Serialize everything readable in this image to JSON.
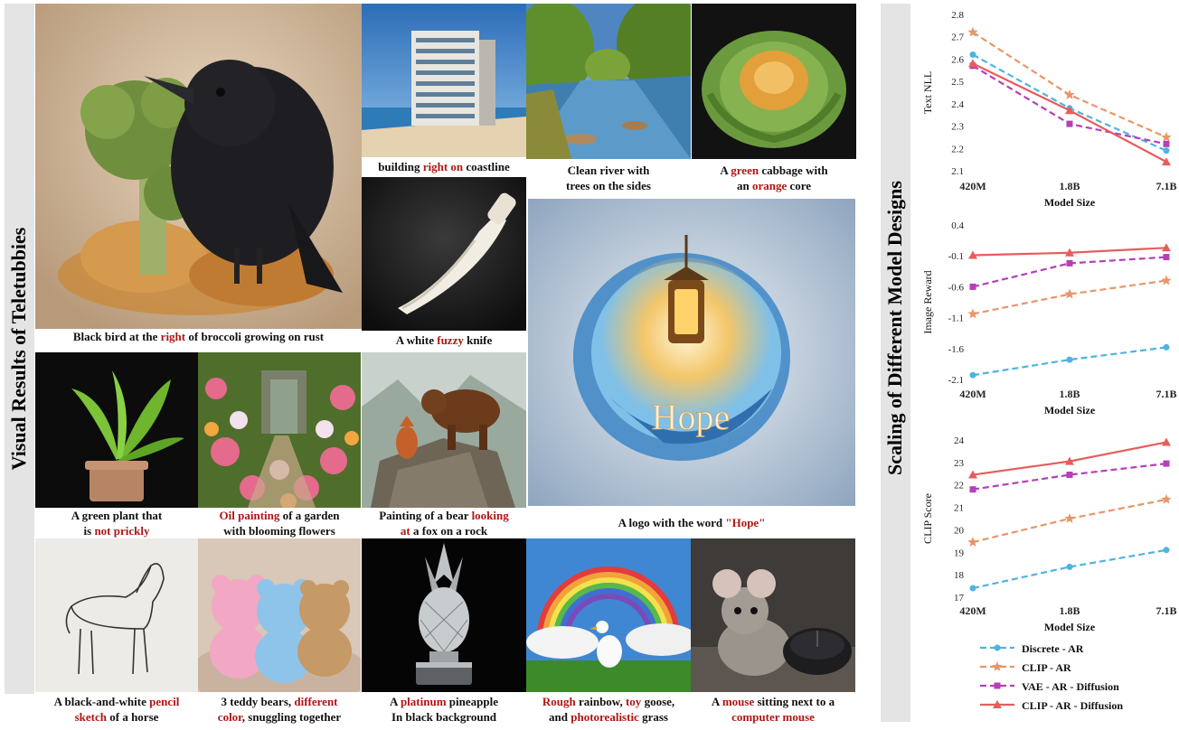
{
  "left_title": "Visual Results of Teletubbies",
  "right_title": "Scaling of Different Model Designs",
  "captions": {
    "bird": [
      "Black bird at the ",
      "right",
      " of broccoli growing on rust"
    ],
    "building": [
      "building ",
      "right on",
      " coastline"
    ],
    "river_1": "Clean river with",
    "river_2": "trees on the sides",
    "cabbage_1": [
      "A ",
      "green",
      " cabbage with"
    ],
    "cabbage_2": [
      "an ",
      "orange",
      " core"
    ],
    "knife": [
      "A white ",
      "fuzzy",
      " knife"
    ],
    "plant_1": "A green plant that",
    "plant_2": [
      "is ",
      "not prickly"
    ],
    "garden_1": [
      "Oil painting",
      " of a garden"
    ],
    "garden_2": "with blooming flowers",
    "bear_1": [
      "Painting of a bear ",
      "looking"
    ],
    "bear_2": [
      "at",
      " a fox on a rock"
    ],
    "logo": [
      "A logo with the word ",
      "\"Hope\""
    ],
    "horse_1": [
      "A black-and-white ",
      "pencil"
    ],
    "horse_2": [
      "sketch",
      " of a horse"
    ],
    "teddy_1": [
      "3 teddy bears, ",
      "different"
    ],
    "teddy_2": [
      "color",
      ", snuggling together"
    ],
    "pineapple_1": [
      "A ",
      "platinum",
      " pineapple"
    ],
    "pineapple_2": "In black background",
    "rainbow_1": [
      "Rough",
      " rainbow, ",
      "toy",
      " goose,"
    ],
    "rainbow_2": [
      "and ",
      "photorealistic",
      " grass"
    ],
    "mouse_1": [
      "A ",
      "mouse",
      " sitting next to a"
    ],
    "mouse_2": [
      "computer mouse"
    ]
  },
  "logo_word": "Hope",
  "colors": {
    "discrete_ar": "#4fb3e0",
    "clip_ar": "#e8956a",
    "vae_ar_diffusion": "#b53fb8",
    "clip_ar_diffusion": "#e85c5c",
    "highlight": "#b01515",
    "sidebar": "#e4e4e4"
  },
  "legend": [
    {
      "name": "Discrete - AR",
      "color": "#4fb3e0",
      "marker": "circle",
      "dashed": true
    },
    {
      "name": "CLIP - AR",
      "color": "#e8956a",
      "marker": "star",
      "dashed": true
    },
    {
      "name": "VAE - AR - Diffusion",
      "color": "#b53fb8",
      "marker": "square",
      "dashed": true
    },
    {
      "name": "CLIP - AR - Diffusion",
      "color": "#e85c5c",
      "marker": "triangle",
      "dashed": false
    }
  ],
  "chart_data": [
    {
      "type": "line",
      "x": [
        "420M",
        "1.8B",
        "7.1B"
      ],
      "xlabel": "Model Size",
      "ylabel": "Text NLL",
      "ylim": [
        2.1,
        2.8
      ],
      "yticks": [
        "2.8",
        "2.7",
        "2.6",
        "2.5",
        "2.4",
        "2.3",
        "2.2",
        "2.1"
      ],
      "series": [
        {
          "name": "Discrete - AR",
          "values": [
            2.62,
            2.38,
            2.19
          ]
        },
        {
          "name": "CLIP - AR",
          "values": [
            2.72,
            2.44,
            2.25
          ]
        },
        {
          "name": "VAE - AR - Diffusion",
          "values": [
            2.57,
            2.31,
            2.22
          ]
        },
        {
          "name": "CLIP - AR - Diffusion",
          "values": [
            2.58,
            2.37,
            2.14
          ]
        }
      ]
    },
    {
      "type": "line",
      "x": [
        "420M",
        "1.8B",
        "7.1B"
      ],
      "xlabel": "Model Size",
      "ylabel": "Image Reward",
      "ylim": [
        -2.1,
        0.4
      ],
      "yticks": [
        "0.4",
        "-0.1",
        "-0.6",
        "-1.1",
        "-1.6",
        "-2.1"
      ],
      "series": [
        {
          "name": "Discrete - AR",
          "values": [
            -2.03,
            -1.78,
            -1.58
          ]
        },
        {
          "name": "CLIP - AR",
          "values": [
            -1.04,
            -0.72,
            -0.5
          ]
        },
        {
          "name": "VAE - AR - Diffusion",
          "values": [
            -0.6,
            -0.22,
            -0.12
          ]
        },
        {
          "name": "CLIP - AR - Diffusion",
          "values": [
            -0.09,
            -0.05,
            0.03
          ]
        }
      ]
    },
    {
      "type": "line",
      "x": [
        "420M",
        "1.8B",
        "7.1B"
      ],
      "xlabel": "Model Size",
      "ylabel": "CLIP Score",
      "ylim": [
        17,
        24
      ],
      "yticks": [
        "24",
        "23",
        "22",
        "21",
        "20",
        "19",
        "18",
        "17"
      ],
      "series": [
        {
          "name": "Discrete - AR",
          "values": [
            17.4,
            18.35,
            19.1
          ]
        },
        {
          "name": "CLIP - AR",
          "values": [
            19.45,
            20.5,
            21.35
          ]
        },
        {
          "name": "VAE - AR - Diffusion",
          "values": [
            21.8,
            22.45,
            22.95
          ]
        },
        {
          "name": "CLIP - AR - Diffusion",
          "values": [
            22.45,
            23.05,
            23.9
          ]
        }
      ]
    }
  ]
}
